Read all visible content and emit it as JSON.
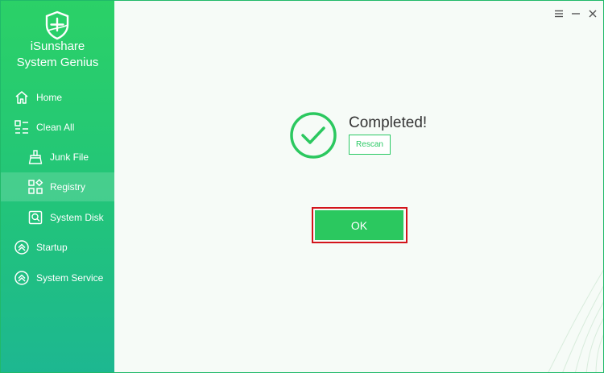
{
  "app": {
    "title_line1": "iSunshare",
    "title_line2": "System Genius"
  },
  "sidebar": {
    "items": [
      {
        "label": "Home",
        "icon": "home-icon"
      },
      {
        "label": "Clean All",
        "icon": "list-icon"
      },
      {
        "label": "Junk File",
        "icon": "broom-icon"
      },
      {
        "label": "Registry",
        "icon": "grid-icon",
        "active": true
      },
      {
        "label": "System Disk",
        "icon": "disk-search-icon"
      },
      {
        "label": "Startup",
        "icon": "chevron-up-circle-icon"
      },
      {
        "label": "System Service",
        "icon": "chevron-up-circle-icon"
      }
    ]
  },
  "window_controls": [
    "menu-icon",
    "minimize-icon",
    "close-icon"
  ],
  "result": {
    "status_text": "Completed!",
    "rescan_label": "Rescan",
    "ok_label": "OK"
  },
  "colors": {
    "accent": "#2bc85f",
    "highlight_border": "#d3141b",
    "sidebar_top": "#2bd167",
    "sidebar_bottom": "#1db791"
  }
}
